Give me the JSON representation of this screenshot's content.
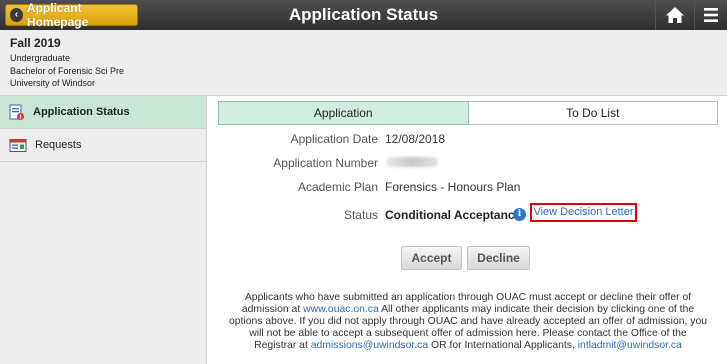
{
  "header": {
    "back_button_label": "Applicant Homepage",
    "title": "Application Status",
    "icons": [
      "chevron-left-icon",
      "home-icon",
      "hamburger-menu-icon"
    ]
  },
  "term": {
    "name": "Fall 2019",
    "career": "Undergraduate",
    "program": "Bachelor of Forensic Sci Pre",
    "institution": "University of Windsor"
  },
  "sidebar": {
    "items": [
      {
        "label": "Application Status",
        "icon": "application-status-icon",
        "active": true
      },
      {
        "label": "Requests",
        "icon": "requests-icon",
        "active": false
      }
    ]
  },
  "tabs": [
    {
      "label": "Application",
      "active": true
    },
    {
      "label": "To Do List",
      "active": false
    }
  ],
  "details": {
    "application_date_label": "Application Date",
    "application_date": "12/08/2018",
    "application_number_label": "Application Number",
    "academic_plan_label": "Academic Plan",
    "academic_plan": "Forensics - Honours Plan",
    "status_label": "Status",
    "status": "Conditional Acceptance",
    "decision_link": "View Decision Letter"
  },
  "actions": {
    "accept_label": "Accept",
    "decline_label": "Decline"
  },
  "notice": {
    "part1": "Applicants who have submitted an application through OUAC must accept or decline their offer of admission at ",
    "ouac_link": "www.ouac.on.ca",
    "part2": " All other applicants may indicate their decision by clicking one of the options above. If you did not apply through OUAC and have already accepted an offer of admission, you will not be able to accept a subsequent offer of admission here. Please contact the Office of the Registrar at ",
    "admissions_email": "admissions@uwindsor.ca",
    "part3": " OR for International Applicants, ",
    "intl_email": "intladmit@uwindsor.ca"
  },
  "colors": {
    "header_bg": "#3a3a3a",
    "home_button": "#e8b31c",
    "active_tab": "#d3ece0",
    "active_sidebar": "#c8e6d6",
    "link": "#2e6db4",
    "highlight_box": "#e00000",
    "info_icon": "#2a78c8"
  }
}
